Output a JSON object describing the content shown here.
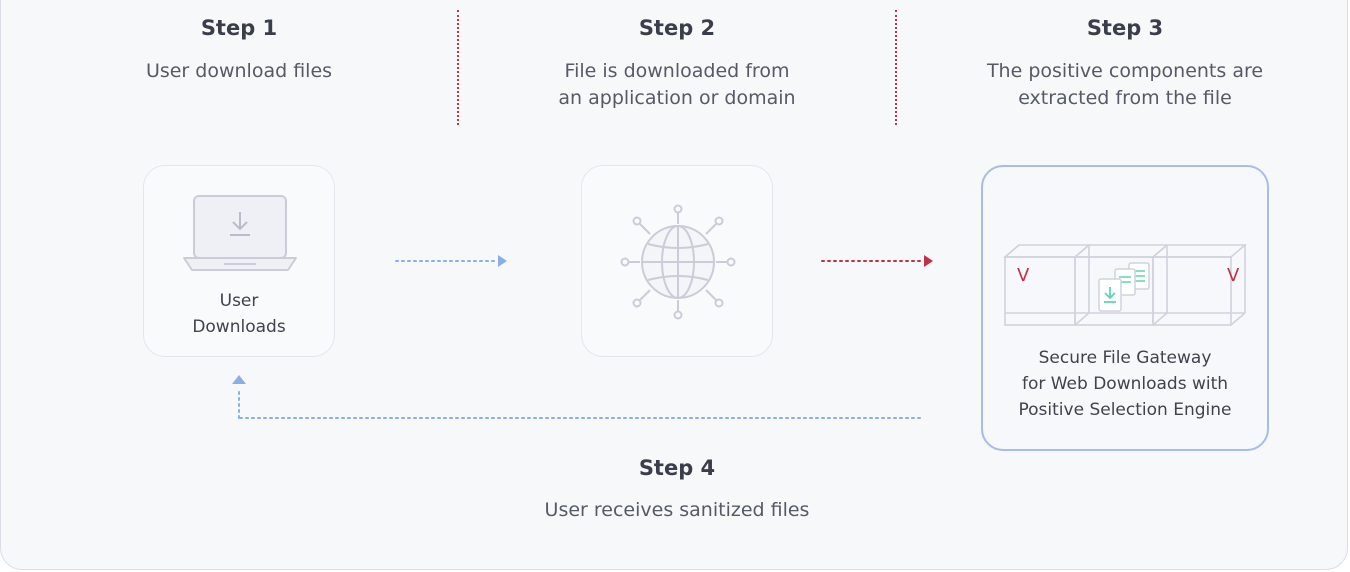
{
  "steps": [
    {
      "title": "Step 1",
      "desc": [
        "User download files"
      ]
    },
    {
      "title": "Step 2",
      "desc": [
        "File is downloaded from",
        "an application or domain"
      ]
    },
    {
      "title": "Step 3",
      "desc": [
        "The positive components are",
        "extracted from the file"
      ]
    },
    {
      "title": "Step 4",
      "desc": [
        "User receives sanitized files"
      ]
    }
  ],
  "nodes": {
    "user": {
      "label": [
        "User",
        "Downloads"
      ],
      "icon": "laptop-download-icon"
    },
    "internet": {
      "label": [],
      "icon": "globe-network-icon"
    },
    "gateway": {
      "label": [
        "Secure File Gateway",
        "for Web Downloads with",
        "Positive Selection Engine"
      ],
      "icon": "containers-file-icon",
      "badge_left": "V",
      "badge_right": "V"
    }
  },
  "colors": {
    "blue_flow": "#8aaee6",
    "red_flow": "#c3304a",
    "panel_bg": "#f7f8fa",
    "card_border": "#e3e6ec",
    "active_border": "#a5bde8",
    "file_accent": "#5fd4b0"
  }
}
